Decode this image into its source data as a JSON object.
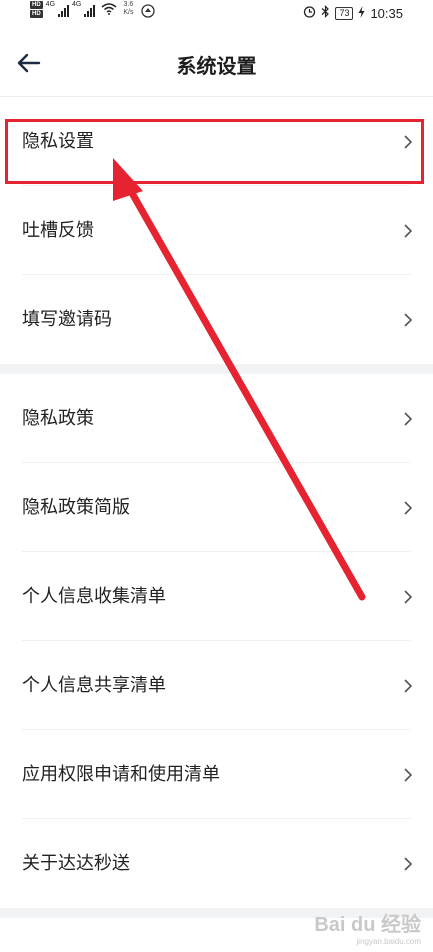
{
  "status_bar": {
    "hd_labels": [
      "HD",
      "HD"
    ],
    "net_labels": [
      "4G",
      "4G"
    ],
    "speed_value": "3.6",
    "speed_unit": "K/s",
    "battery": "73",
    "time": "10:35"
  },
  "header": {
    "title": "系统设置"
  },
  "settings": {
    "group1": [
      "隐私设置",
      "吐槽反馈",
      "填写邀请码"
    ],
    "group2": [
      "隐私政策",
      "隐私政策简版",
      "个人信息收集清单",
      "个人信息共享清单",
      "应用权限申请和使用清单",
      "关于达达秒送"
    ]
  },
  "annotation": {
    "highlight_color": "#e62330"
  },
  "watermark": {
    "main": "Bai du 经验",
    "sub": "jingyan.baidu.com"
  },
  "colors": {
    "background": "#ffffff",
    "section_gap": "#f2f3f5",
    "divider": "#f0f0f0",
    "text": "#222222"
  }
}
